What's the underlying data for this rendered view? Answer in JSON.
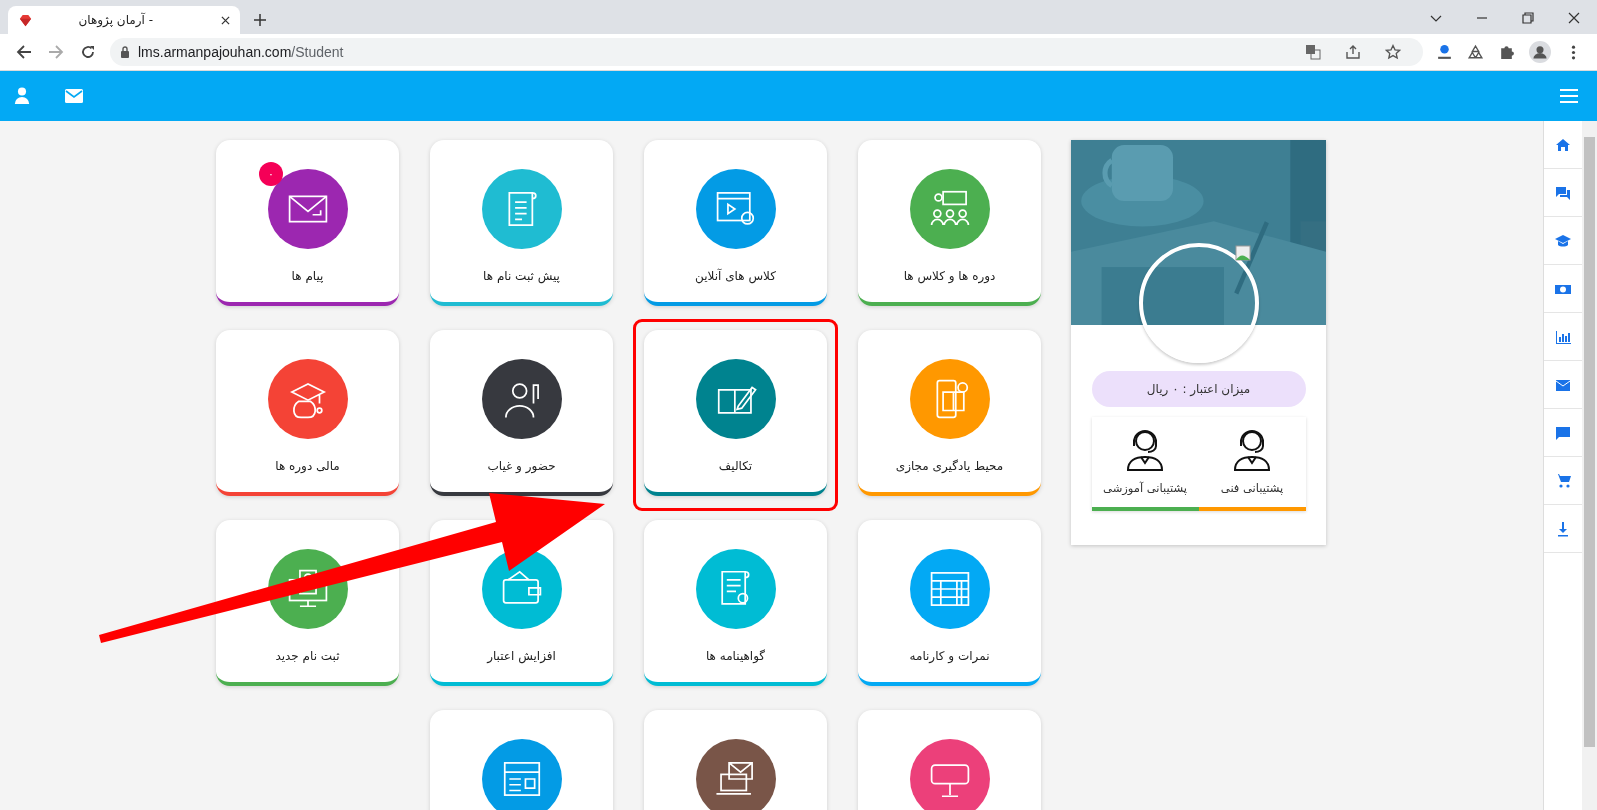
{
  "browser": {
    "tab": {
      "title": "- آرمان پژوهان"
    },
    "address": {
      "host": "lms.armanpajouhan.com",
      "path": "/Student"
    }
  },
  "tiles": [
    {
      "label": "دوره ها و کلاس ها",
      "color": "#4caf50",
      "highlighted": false
    },
    {
      "label": "کلاس های آنلاین",
      "color": "#039be5",
      "highlighted": false
    },
    {
      "label": "پیش ثبت نام ها",
      "color": "#1fbcd2",
      "highlighted": false
    },
    {
      "label": "پیام ها",
      "color": "#9c27b0",
      "highlighted": false,
      "badge": "۰"
    },
    {
      "label": "محیط یادگیری مجازی",
      "color": "#ff9800",
      "highlighted": false
    },
    {
      "label": "تکالیف",
      "color": "#00838f",
      "highlighted": true
    },
    {
      "label": "حضور و غیاب",
      "color": "#37393f",
      "highlighted": false
    },
    {
      "label": "مالی دوره ها",
      "color": "#f44336",
      "highlighted": false
    },
    {
      "label": "نمرات و کارنامه",
      "color": "#03a9f4",
      "highlighted": false
    },
    {
      "label": "گواهینامه ها",
      "color": "#00bcd4",
      "highlighted": false
    },
    {
      "label": "افزایش اعتبار",
      "color": "#00bcd4",
      "highlighted": false
    },
    {
      "label": "ثبت نام جدید",
      "color": "#4caf50",
      "highlighted": false
    },
    {
      "color": "#ec407a",
      "highlighted": false
    },
    {
      "color": "#795548",
      "highlighted": false
    },
    {
      "color": "#039be5",
      "highlighted": false
    }
  ],
  "profile": {
    "credit": "میزان اعتبار : ۰ ریال",
    "support": [
      {
        "label": "پشتیبانی فنی",
        "color": "#ff9800"
      },
      {
        "label": "پشتیبانی آموزشی",
        "color": "#4caf50"
      }
    ]
  }
}
